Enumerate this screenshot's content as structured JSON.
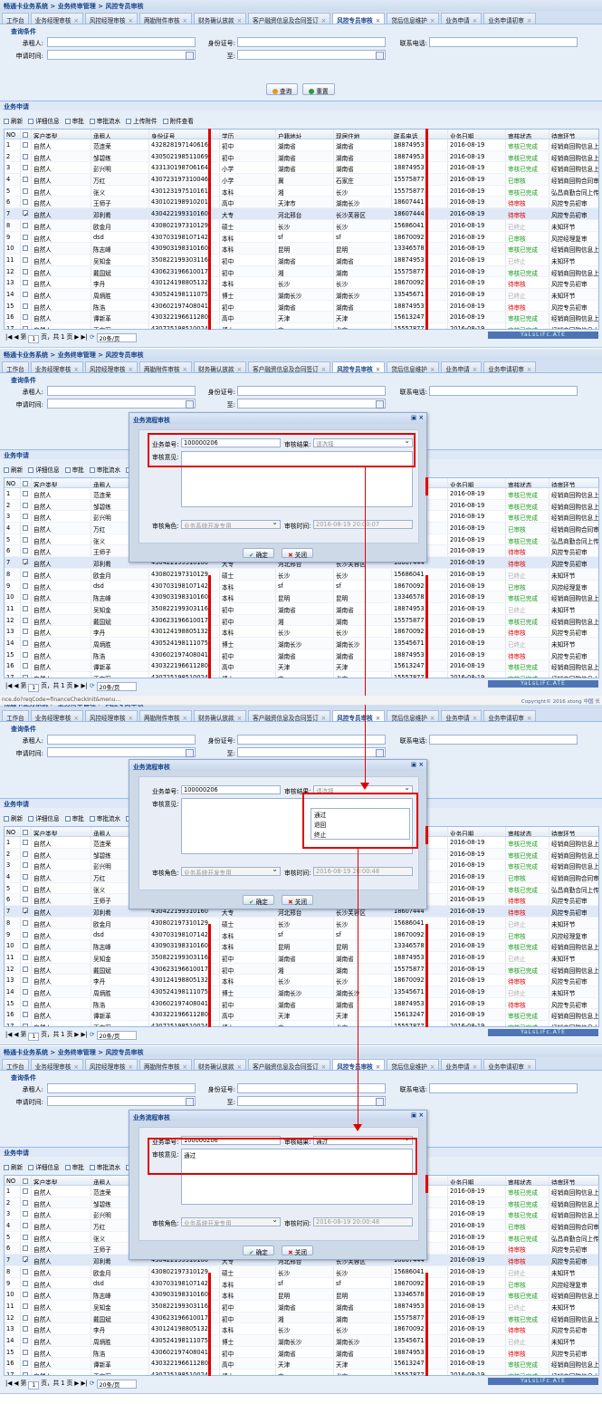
{
  "app": {
    "breadcrumb": "畅通卡业务系统 > 业务终审管理 > 风控专员审核"
  },
  "tabs": [
    {
      "label": "工作台",
      "active": false,
      "closable": false
    },
    {
      "label": "业务经理审核",
      "active": false,
      "closable": true
    },
    {
      "label": "风控经理审核",
      "active": false,
      "closable": true
    },
    {
      "label": "两勘附件审核",
      "active": false,
      "closable": true
    },
    {
      "label": "财务确认放款",
      "active": false,
      "closable": true
    },
    {
      "label": "客户融资信息及合同签订",
      "active": false,
      "closable": true
    },
    {
      "label": "风控专员审核",
      "active": true,
      "closable": true
    },
    {
      "label": "贷后信息维护",
      "active": false,
      "closable": true
    },
    {
      "label": "业务申请",
      "active": false,
      "closable": true
    },
    {
      "label": "业务申请初审",
      "active": false,
      "closable": true
    }
  ],
  "query": {
    "section_title": "查询条件",
    "renter_label": "承租人:",
    "idcard_label": "身份证号:",
    "phone_label": "联系电话:",
    "apply_time_label": "申请时间:",
    "to_label": "至:",
    "search_button": "查询",
    "reset_button": "重置"
  },
  "business": {
    "section_title": "业务申请",
    "toolbar": [
      "刷新",
      "详细信息",
      "审批",
      "审批流水",
      "上传附件",
      "附件查看"
    ]
  },
  "grid": {
    "columns": [
      "NO",
      "",
      "客户类型",
      "承租人",
      "身份证号",
      "学历",
      "户籍地址",
      "现居住地",
      "联系电话",
      "业务日期",
      "审核状态",
      "待审环节"
    ],
    "rows": [
      [
        "1",
        "自然人",
        "范连荣",
        "432828197140616",
        "初中",
        "湖南省",
        "湖南省",
        "18874953",
        "2016-08-19",
        "审核已完成",
        "经销商回购信息上"
      ],
      [
        "2",
        "自然人",
        "邹碧练",
        "430502198511069",
        "初中",
        "湖南省",
        "湖南省",
        "18874953",
        "2016-08-19",
        "审核已完成",
        "经销商回购信息上"
      ],
      [
        "3",
        "自然人",
        "彭兴明",
        "433130198706164",
        "小学",
        "湖南省",
        "湖南省",
        "18874953",
        "2016-08-19",
        "审核已完成",
        "经销商回购信息上"
      ],
      [
        "4",
        "自然人",
        "万红",
        "430723197310046",
        "小学",
        "冀",
        "石家庄",
        "15575877",
        "2016-08-19",
        "已审核",
        "经销商回购合同审"
      ],
      [
        "5",
        "自然人",
        "张义",
        "430123197510161",
        "本科",
        "湘",
        "长沙",
        "15575877",
        "2016-08-19",
        "审核已完成",
        "弘昌商勤合同上传"
      ],
      [
        "6",
        "自然人",
        "王师子",
        "430102198910201",
        "高中",
        "天津市",
        "湖南长沙",
        "18607441",
        "2016-08-19",
        "待审核",
        "风控专员初审"
      ],
      [
        "7",
        "自然人",
        "邓利肴",
        "430422199310160",
        "大专",
        "河北邢台",
        "长沙芙蓉区",
        "18607444",
        "2016-08-19",
        "待审核",
        "风控专员初审"
      ],
      [
        "8",
        "自然人",
        "欧金月",
        "430802197310129",
        "硕士",
        "长沙",
        "长沙",
        "15686041",
        "2016-08-19",
        "已终止",
        "未知环节"
      ],
      [
        "9",
        "自然人",
        "dsd",
        "430703198107142",
        "本科",
        "sf",
        "sf",
        "18670092",
        "2016-08-19",
        "已审核",
        "风控经理复审"
      ],
      [
        "10",
        "自然人",
        "陈志峰",
        "430903198310160",
        "本科",
        "昆明",
        "昆明",
        "13346578",
        "2016-08-19",
        "审核已完成",
        "经销商回购信息上"
      ],
      [
        "11",
        "自然人",
        "吴知金",
        "350822199303116",
        "初中",
        "湖南省",
        "湖南省",
        "18874953",
        "2016-08-19",
        "已终止",
        "未知环节"
      ],
      [
        "12",
        "自然人",
        "戴国斌",
        "430623196610017",
        "初中",
        "湘",
        "湖南",
        "15575877",
        "2016-08-19",
        "审核已完成",
        "经销商回购信息上"
      ],
      [
        "13",
        "自然人",
        "李丹",
        "430124198805132",
        "本科",
        "长沙",
        "长沙",
        "18670092",
        "2016-08-19",
        "待审核",
        "风控专员初审"
      ],
      [
        "14",
        "自然人",
        "周炳胜",
        "430524198111075",
        "博士",
        "湖南长沙",
        "湖南长沙",
        "13545671",
        "2016-08-19",
        "已终止",
        "未知环节"
      ],
      [
        "15",
        "自然人",
        "陈浩",
        "430602197408041",
        "初中",
        "湖南省",
        "湖南省",
        "18874953",
        "2016-08-19",
        "待审核",
        "风控专员初审"
      ],
      [
        "16",
        "自然人",
        "谭新革",
        "430322196611280",
        "高中",
        "天津",
        "天津",
        "15613247",
        "2016-08-19",
        "审核已完成",
        "经销商回购信息上"
      ],
      [
        "17",
        "自然人",
        "王京军",
        "430725198510024",
        "博士",
        "京",
        "北京",
        "15557877",
        "2016-08-19",
        "审核已完成",
        "经销商回购信息上"
      ]
    ]
  },
  "pager": {
    "page_label": "第",
    "page_value": "1",
    "page_of": "页，共 1 页",
    "page_size": "20条/页"
  },
  "watermark": "YaLsLiFc.ATE",
  "url_text": "nce.do?reqCode=financeCheckInit&menu...",
  "copyright": "Copyright© 2016 xtong 中国 长",
  "dialog": {
    "title": "业务流程审核",
    "biz_no_label": "业务单号:",
    "biz_no_value": "100000206",
    "result_label": "审核结果:",
    "result_placeholder": "请选择",
    "opinion_label": "审核意见:",
    "role_label": "审核角色:",
    "role_value": "业务系统开发专用",
    "time_label": "审核时间:",
    "time_value_1": "2016-08-19 20:00:07",
    "time_value_2": "2016-08-19 20:00:48",
    "confirm_button": "确定",
    "close_button": "关闭",
    "options": [
      "通过",
      "退回",
      "终止"
    ],
    "selected_result": "通过",
    "opinion_value": "通过"
  },
  "colors": {
    "accent": "#15428b",
    "highlight": "#e00000",
    "status_done": "#1a9b1a",
    "status_pending": "#d90000"
  }
}
